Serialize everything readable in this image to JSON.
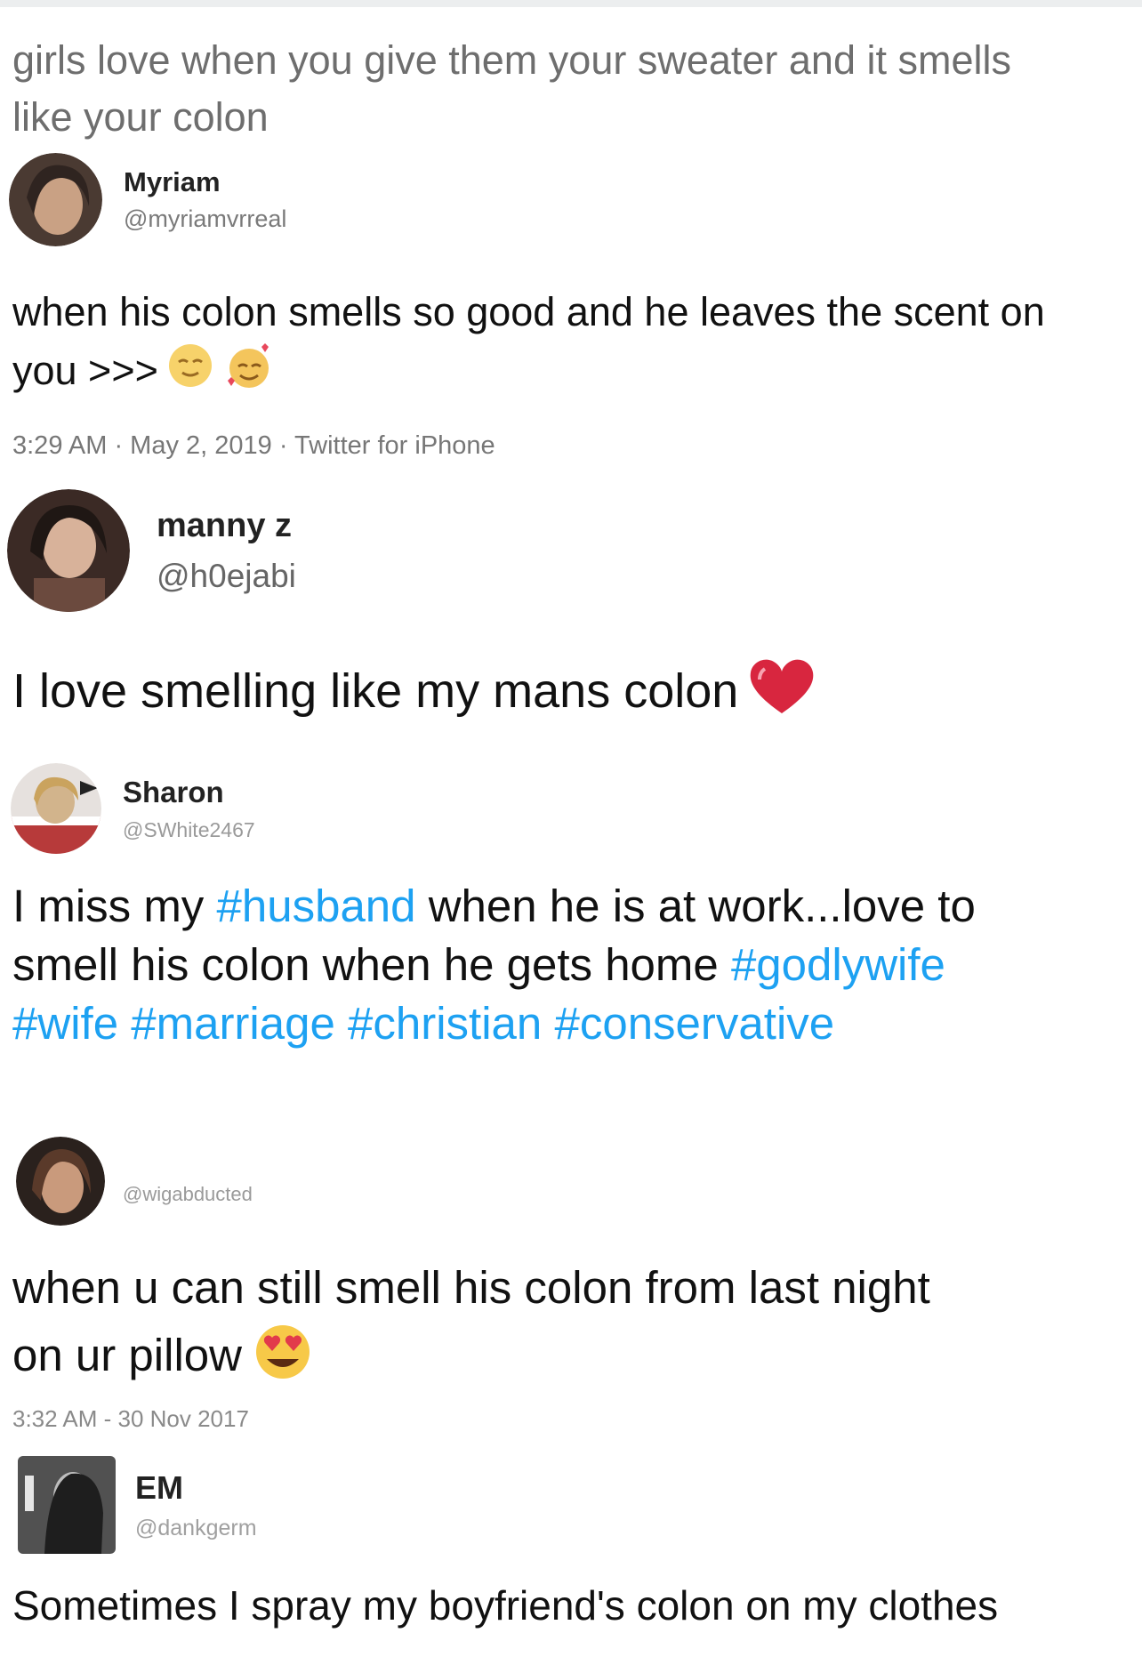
{
  "top_caption": "girls love when you give them your sweater and it smells like your colon",
  "tweets": [
    {
      "name": "Myriam",
      "handle": "@myriamvrreal",
      "text": "when his colon smells so good and he leaves the scent on you >>>",
      "emojis": [
        "relieved-face-icon",
        "smiling-face-with-hearts-icon"
      ],
      "meta": "3:29 AM · May 2, 2019 · Twitter for iPhone"
    },
    {
      "name": "manny z",
      "handle": "@h0ejabi",
      "text": "I love smelling like my mans colon",
      "emojis": [
        "heart-icon"
      ]
    },
    {
      "name": "Sharon",
      "handle": "@SWhite2467",
      "text_parts": {
        "t1": "I miss my ",
        "h1": "#husband",
        "t2": " when he is at work...love to smell his colon when he gets home ",
        "h2": "#godlywife",
        "h3": "#wife",
        "h4": "#marriage",
        "h5": "#christian",
        "h6": "#conservative"
      }
    },
    {
      "name": "",
      "handle": "@wigabducted",
      "text": "when u can still smell his colon from last night on ur pillow",
      "emojis": [
        "heart-eyes-icon"
      ],
      "meta": "3:32 AM - 30 Nov 2017"
    },
    {
      "name": "EM",
      "handle": "@dankgerm",
      "text": "Sometimes I spray my boyfriend's colon on my clothes"
    }
  ],
  "colors": {
    "hashtag": "#1da1f2",
    "secondary_text": "#777777"
  }
}
